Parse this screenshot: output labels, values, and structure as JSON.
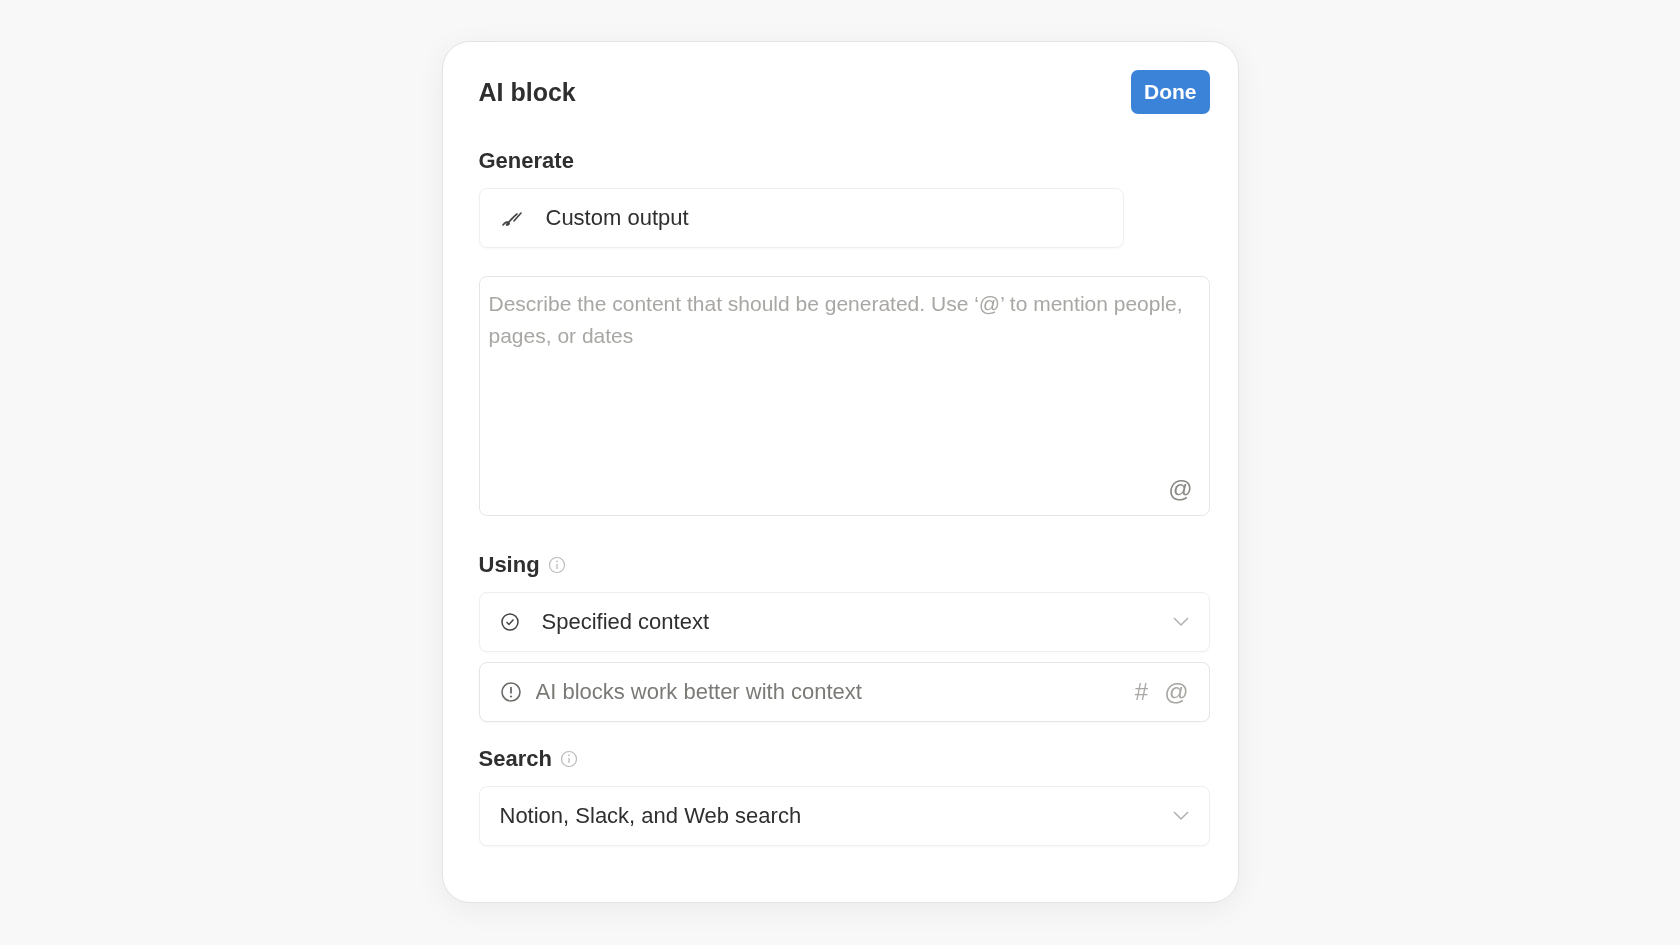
{
  "dialog": {
    "title": "AI block",
    "done_button": "Done"
  },
  "generate": {
    "label": "Generate",
    "output": "Custom output",
    "prompt": {
      "placeholder": "Describe the content that should be generated. Use ‘@’ to mention people, pages, or dates",
      "mention_glyph": "@"
    }
  },
  "using": {
    "label": "Using",
    "selected": "Specified context",
    "context_field": {
      "placeholder": "AI blocks work better with context",
      "glyphs": [
        "#",
        "@"
      ]
    }
  },
  "search": {
    "label": "Search",
    "selected": "Notion, Slack, and Web search"
  }
}
